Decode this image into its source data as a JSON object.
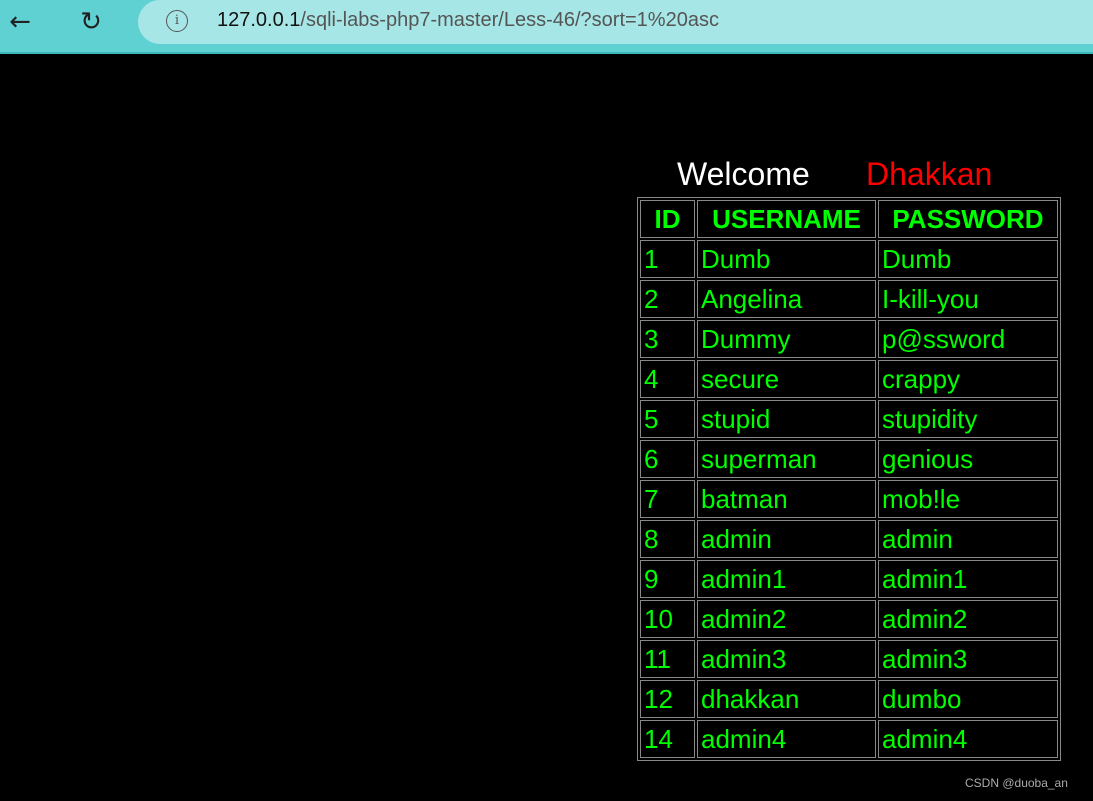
{
  "browser": {
    "url_host": "127.0.0.1",
    "url_path": "/sqli-labs-php7-master/Less-46/?sort=1%20asc",
    "back_icon": "arrow-left",
    "reload_icon": "reload",
    "info_icon": "info"
  },
  "page": {
    "welcome": "Welcome",
    "user": "Dhakkan",
    "headers": [
      "ID",
      "USERNAME",
      "PASSWORD"
    ],
    "rows": [
      [
        "1",
        "Dumb",
        "Dumb"
      ],
      [
        "2",
        "Angelina",
        "I-kill-you"
      ],
      [
        "3",
        "Dummy",
        "p@ssword"
      ],
      [
        "4",
        "secure",
        "crappy"
      ],
      [
        "5",
        "stupid",
        "stupidity"
      ],
      [
        "6",
        "superman",
        "genious"
      ],
      [
        "7",
        "batman",
        "mob!le"
      ],
      [
        "8",
        "admin",
        "admin"
      ],
      [
        "9",
        "admin1",
        "admin1"
      ],
      [
        "10",
        "admin2",
        "admin2"
      ],
      [
        "11",
        "admin3",
        "admin3"
      ],
      [
        "12",
        "dhakkan",
        "dumbo"
      ],
      [
        "14",
        "admin4",
        "admin4"
      ]
    ]
  },
  "watermark": "CSDN @duoba_an",
  "colors": {
    "text": "#00ff00",
    "name": "#ff0000",
    "background": "#000000"
  }
}
